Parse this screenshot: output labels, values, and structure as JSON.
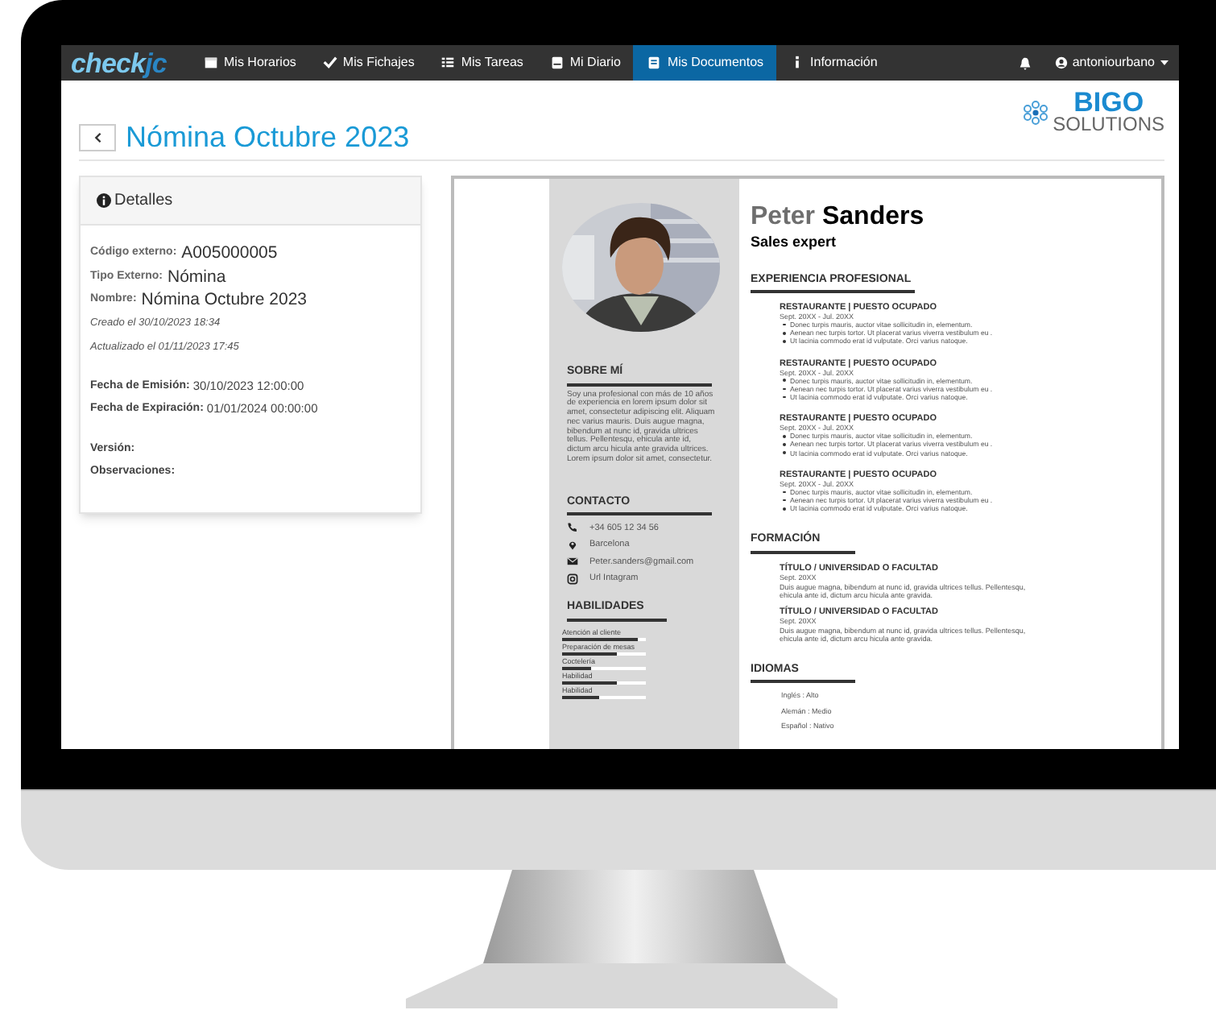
{
  "navbar": {
    "logo": {
      "main": "check",
      "accent": "jc"
    },
    "items": [
      {
        "label": "Mis Horarios",
        "selected": false
      },
      {
        "label": "Mis Fichajes",
        "selected": false
      },
      {
        "label": "Mis Tareas",
        "selected": false
      },
      {
        "label": "Mi Diario",
        "selected": false
      },
      {
        "label": "Mis Documentos",
        "selected": true
      },
      {
        "label": "Información",
        "selected": false
      }
    ],
    "user": "antoniourbano"
  },
  "brand_logo": {
    "main": "BIGO",
    "sub": "SOLUTIONS"
  },
  "page_title": "Nómina Octubre 2023",
  "details": {
    "title": "Detalles",
    "groups": [
      [
        {
          "kind": "main",
          "label": "Código externo:",
          "value": "A005000005"
        },
        {
          "kind": "main",
          "label": "Tipo Externo:",
          "value": "Nómina"
        },
        {
          "kind": "main",
          "label": "Nombre:",
          "value": "Nómina Octubre 2023"
        },
        {
          "kind": "meta",
          "label": "Creado el 30/10/2023 18:34"
        },
        {
          "kind": "meta",
          "label": "Actualizado el 01/11/2023 17:45"
        }
      ],
      [
        {
          "kind": "date",
          "label": "Fecha de Emisión:",
          "value": "30/10/2023 12:00:00"
        },
        {
          "kind": "date",
          "label": "Fecha de Expiración:",
          "value": "01/01/2024 00:00:00"
        }
      ],
      [
        {
          "kind": "date",
          "label": "Versión:"
        },
        {
          "kind": "date",
          "label": "Observaciones:"
        }
      ]
    ]
  },
  "document": {
    "first_name": "Peter",
    "last_name": "Sanders",
    "role": "Sales expert",
    "about": {
      "title": "SOBRE MÍ",
      "text": "Soy una profesional con más de 10 años de experiencia en lorem ipsum dolor sit amet, consectetur adipiscing elit. Aliquam nec varius mauris. Duis augue magna, bibendum at nunc id, gravida ultrices tellus. Pellentesqu, ehicula ante id, dictum arcu hicula ante gravida ultrices. Lorem ipsum dolor sit amet, consectetur."
    },
    "contact": {
      "title": "CONTACTO",
      "items": [
        "+34 605 12 34 56",
        "Barcelona",
        "Peter.sanders@gmail.com",
        "Url Intagram"
      ]
    },
    "skills": {
      "title": "HABILIDADES",
      "items": [
        {
          "label": "Atención al cliente",
          "level": 0.9
        },
        {
          "label": "Preparación de mesas",
          "level": 0.65
        },
        {
          "label": "Coctelería",
          "level": 0.35
        },
        {
          "label": "Habilidad",
          "level": 0.65
        },
        {
          "label": "Habilidad",
          "level": 0.45
        }
      ]
    },
    "experience": {
      "title": "EXPERIENCIA PROFESIONAL",
      "jobs": [
        {
          "title": "RESTAURANTE | PUESTO OCUPADO",
          "dates": "Sept. 20XX - Jul. 20XX",
          "bullets": [
            "Donec turpis mauris, auctor vitae sollicitudin in, elementum.",
            "Aenean nec turpis tortor. Ut placerat varius viverra vestibulum eu .",
            "Ut lacinia commodo erat id vulputate. Orci varius natoque."
          ]
        },
        {
          "title": "RESTAURANTE | PUESTO OCUPADO",
          "dates": "Sept. 20XX - Jul. 20XX",
          "bullets": [
            "Donec turpis mauris, auctor vitae sollicitudin in, elementum.",
            "Aenean nec turpis tortor. Ut placerat varius viverra vestibulum eu .",
            "Ut lacinia commodo erat id vulputate. Orci varius natoque."
          ]
        },
        {
          "title": "RESTAURANTE | PUESTO OCUPADO",
          "dates": "Sept. 20XX - Jul. 20XX",
          "bullets": [
            "Donec turpis mauris, auctor vitae sollicitudin in, elementum.",
            "Aenean nec turpis tortor. Ut placerat varius viverra vestibulum eu .",
            "Ut lacinia commodo erat id vulputate. Orci varius natoque."
          ]
        },
        {
          "title": "RESTAURANTE | PUESTO OCUPADO",
          "dates": "Sept. 20XX - Jul. 20XX",
          "bullets": [
            "Donec turpis mauris, auctor vitae sollicitudin in, elementum.",
            "Aenean nec turpis tortor. Ut placerat varius viverra vestibulum eu .",
            "Ut lacinia commodo erat id vulputate. Orci varius natoque."
          ]
        }
      ]
    },
    "education": {
      "title": "FORMACIÓN",
      "items": [
        {
          "title": "TÍTULO / UNIVERSIDAD O FACULTAD",
          "dates": "Sept. 20XX",
          "text": "Duis augue magna, bibendum at nunc id, gravida ultrices tellus. Pellentesqu, ehicula ante id, dictum arcu hicula ante gravida."
        },
        {
          "title": "TÍTULO / UNIVERSIDAD O FACULTAD",
          "dates": "Sept. 20XX",
          "text": "Duis augue magna, bibendum at nunc id, gravida ultrices tellus. Pellentesqu, ehicula ante id, dictum arcu hicula ante gravida."
        }
      ]
    },
    "languages": {
      "title": "IDIOMAS",
      "items": [
        "Inglés : Alto",
        "Alemán : Medio",
        "Español : Nativo"
      ]
    }
  }
}
